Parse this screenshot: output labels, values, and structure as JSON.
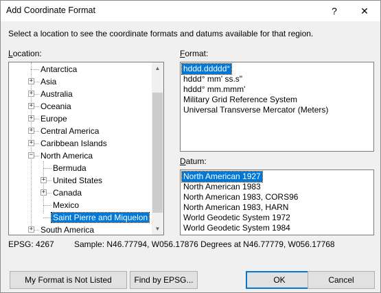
{
  "window": {
    "title": "Add Coordinate Format",
    "help_label": "?",
    "close_label": "✕"
  },
  "instruction": "Select a location to see the coordinate formats and datums available for that region.",
  "location": {
    "label": "Location:",
    "items": [
      {
        "label": "Antarctica"
      },
      {
        "label": "Asia"
      },
      {
        "label": "Australia"
      },
      {
        "label": "Oceania"
      },
      {
        "label": "Europe"
      },
      {
        "label": "Central America"
      },
      {
        "label": "Caribbean Islands"
      },
      {
        "label": "North America"
      },
      {
        "label": "Bermuda"
      },
      {
        "label": "United States"
      },
      {
        "label": "Canada"
      },
      {
        "label": "Mexico"
      },
      {
        "label": "Saint Pierre and Miquelon"
      },
      {
        "label": "South America"
      }
    ],
    "expand_glyph": "+",
    "collapse_glyph": "−",
    "scroll_up_glyph": "▲",
    "scroll_down_glyph": "▼"
  },
  "format": {
    "label": "Format:",
    "items": [
      "hddd.ddddd°",
      "hddd° mm' ss.s\"",
      "hddd° mm.mmm'",
      "Military Grid Reference System",
      "Universal Transverse Mercator (Meters)"
    ],
    "selected_index": 0
  },
  "datum": {
    "label": "Datum:",
    "items": [
      "North American 1927",
      "North American 1983",
      "North American 1983, CORS96",
      "North American 1983, HARN",
      "World Geodetic System 1972",
      "World Geodetic System 1984"
    ],
    "selected_index": 0
  },
  "status": {
    "epsg": "EPSG: 4267",
    "sample": "Sample: N46.77794, W056.17876 Degrees at N46.77779, W056.17768"
  },
  "buttons": {
    "not_listed": "My Format is Not Listed",
    "find_epsg": "Find by EPSG...",
    "ok": "OK",
    "cancel": "Cancel"
  }
}
